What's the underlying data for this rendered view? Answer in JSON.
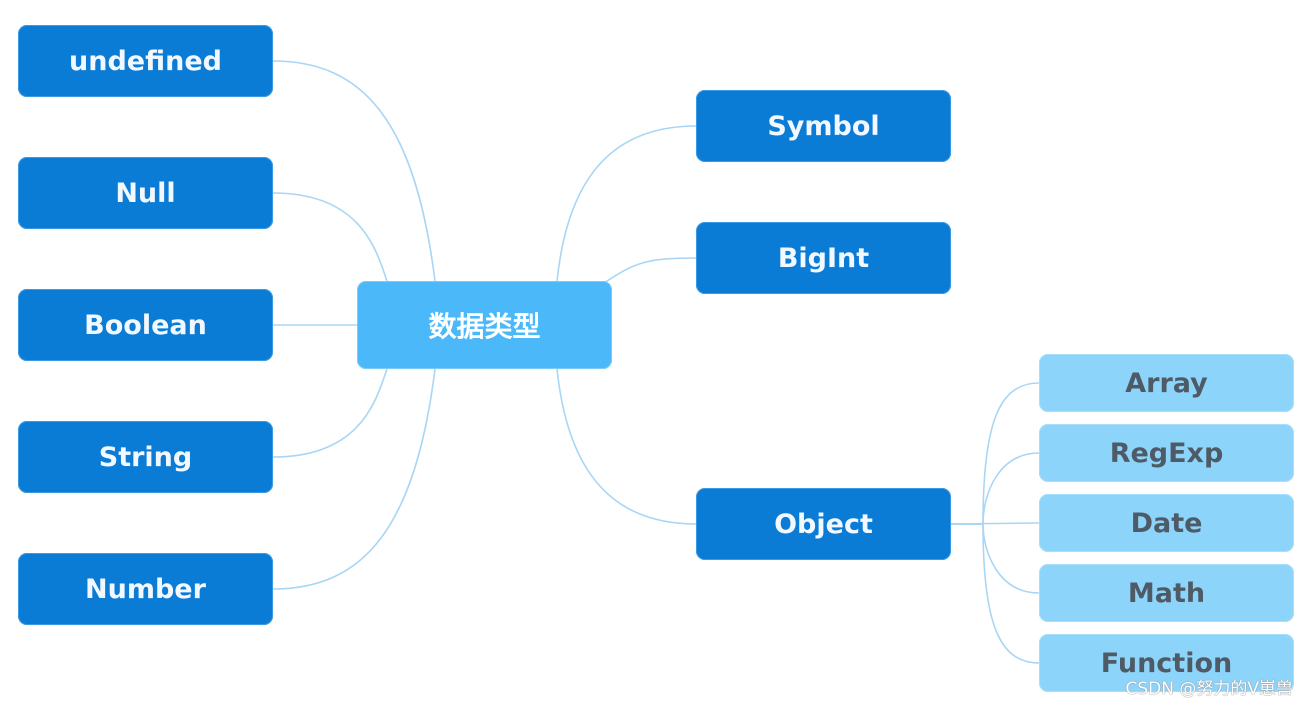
{
  "diagram": {
    "type": "mind-map",
    "root": {
      "id": "root",
      "label": "数据类型"
    },
    "left_branches": [
      {
        "id": "undefined",
        "label": "undefined"
      },
      {
        "id": "null",
        "label": "Null"
      },
      {
        "id": "boolean",
        "label": "Boolean"
      },
      {
        "id": "string",
        "label": "String"
      },
      {
        "id": "number",
        "label": "Number"
      }
    ],
    "right_branches": [
      {
        "id": "symbol",
        "label": "Symbol"
      },
      {
        "id": "bigint",
        "label": "BigInt"
      },
      {
        "id": "object",
        "label": "Object",
        "children": [
          {
            "id": "array",
            "label": "Array"
          },
          {
            "id": "regexp",
            "label": "RegExp"
          },
          {
            "id": "date",
            "label": "Date"
          },
          {
            "id": "math",
            "label": "Math"
          },
          {
            "id": "function",
            "label": "Function"
          }
        ]
      }
    ],
    "edges": [
      [
        "root",
        "undefined"
      ],
      [
        "root",
        "null"
      ],
      [
        "root",
        "boolean"
      ],
      [
        "root",
        "string"
      ],
      [
        "root",
        "number"
      ],
      [
        "root",
        "symbol"
      ],
      [
        "root",
        "bigint"
      ],
      [
        "root",
        "object"
      ],
      [
        "object",
        "array"
      ],
      [
        "object",
        "regexp"
      ],
      [
        "object",
        "date"
      ],
      [
        "object",
        "math"
      ],
      [
        "object",
        "function"
      ]
    ],
    "colors": {
      "primary_node": "#0a7cd6",
      "root_node": "#4bb8fa",
      "child_node": "#8dd4fb",
      "connector": "#a9d6f5",
      "child_text": "#4e5b66"
    }
  },
  "watermark": "CSDN @努力的V崽兽"
}
